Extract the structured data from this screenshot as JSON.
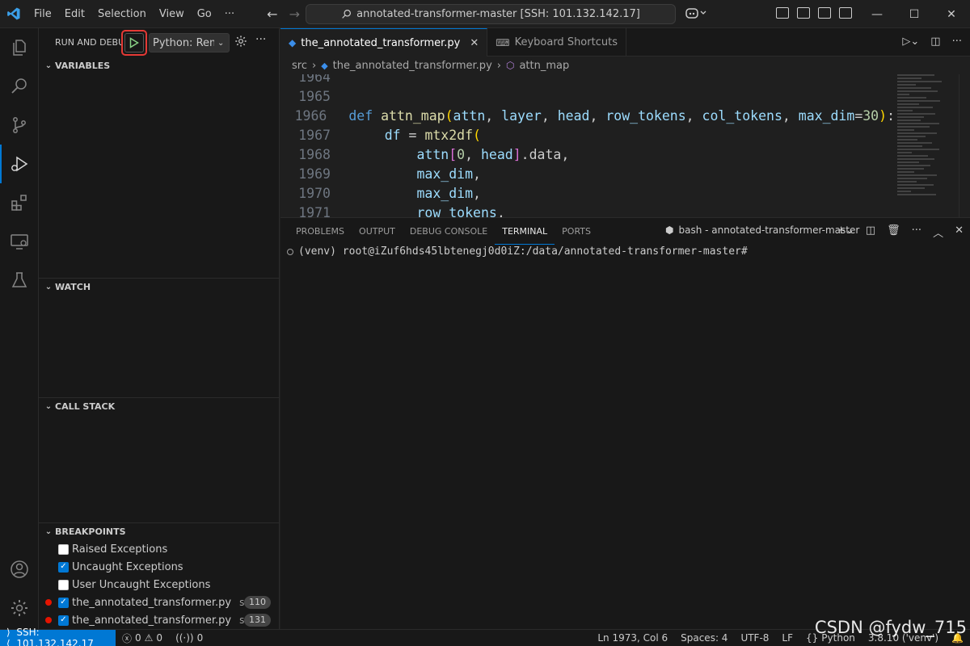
{
  "titlebar": {
    "menu": [
      "File",
      "Edit",
      "Selection",
      "View",
      "Go",
      "···"
    ],
    "search_text": "annotated-transformer-master [SSH: 101.132.142.17]"
  },
  "sidebar": {
    "title": "RUN AND DEBUG",
    "config": "Python: Remote",
    "sections": {
      "variables": "VARIABLES",
      "watch": "WATCH",
      "call_stack": "CALL STACK",
      "breakpoints": "BREAKPOINTS"
    },
    "breakpoints": [
      {
        "label": "Raised Exceptions",
        "checked": false
      },
      {
        "label": "Uncaught Exceptions",
        "checked": true
      },
      {
        "label": "User Uncaught Exceptions",
        "checked": false
      },
      {
        "label": "the_annotated_transformer.py",
        "checked": true,
        "path": "src",
        "line": "110"
      },
      {
        "label": "the_annotated_transformer.py",
        "checked": true,
        "path": "src",
        "line": "131"
      }
    ]
  },
  "editor": {
    "tabs": [
      {
        "label": "the_annotated_transformer.py",
        "active": true
      },
      {
        "label": "Keyboard Shortcuts",
        "active": false
      }
    ],
    "breadcrumbs": [
      "src",
      "the_annotated_transformer.py",
      "attn_map"
    ],
    "line_numbers": [
      "1964",
      "1965",
      "1966",
      "1967",
      "1968",
      "1969",
      "1970",
      "1971"
    ],
    "lines": [
      "",
      "",
      "def attn_map(attn, layer, head, row_tokens, col_tokens, max_dim=30):",
      "    df = mtx2df(",
      "        attn[0, head].data,",
      "        max_dim,",
      "        max_dim,",
      "        row_tokens,"
    ]
  },
  "panel": {
    "tabs": [
      "PROBLEMS",
      "OUTPUT",
      "DEBUG CONSOLE",
      "TERMINAL",
      "PORTS"
    ],
    "active_tab": "TERMINAL",
    "terminal_name": "bash - annotated-transformer-master",
    "terminal_line": "(venv) root@iZuf6hds45lbtenegj0d0iZ:/data/annotated-transformer-master#"
  },
  "statusbar": {
    "remote": "SSH: 101.132.142.17",
    "errors": "0",
    "warnings": "0",
    "ports": "0",
    "position": "Ln 1973, Col 6",
    "spaces": "Spaces: 4",
    "encoding": "UTF-8",
    "eol": "LF",
    "language": "Python",
    "interpreter": "3.8.10 ('venv')"
  },
  "watermark": "CSDN @fydw_715",
  "colors": {
    "accent": "#0078d4",
    "highlight": "#e53935",
    "breakpoint": "#e51400"
  }
}
